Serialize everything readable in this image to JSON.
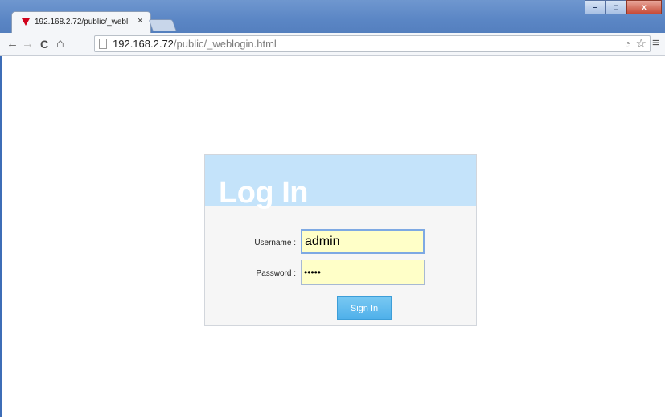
{
  "browser": {
    "tab": {
      "title": "192.168.2.72/public/_webl",
      "close_glyph": "×"
    },
    "window_controls": {
      "minimize": "–",
      "maximize": "□",
      "close": "x"
    },
    "nav": {
      "back": "←",
      "forward": "→",
      "reload": "C",
      "home": "⌂"
    },
    "address": {
      "host": "192.168.2.72",
      "path": "/public/_weblogin.html"
    },
    "menu_glyph": "≡",
    "star_glyph": "☆"
  },
  "login": {
    "title": "Log In",
    "username_label": "Username :",
    "username_value": "admin",
    "password_label": "Password :",
    "password_value": "•••••",
    "signin_label": "Sign In"
  },
  "colors": {
    "header_bg": "#c4e3fa",
    "field_bg": "#ffffc8",
    "button_bg": "#5ab8ee",
    "favicon": "#d0021b"
  }
}
